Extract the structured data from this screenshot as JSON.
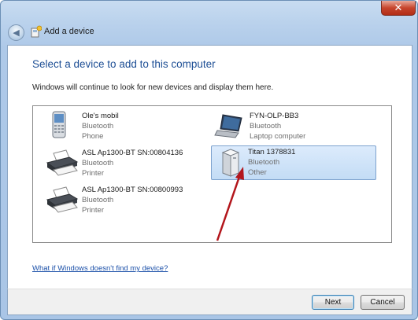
{
  "window": {
    "title": "Add a device",
    "close_glyph": "✕"
  },
  "header": {
    "heading": "Select a device to add to this computer",
    "subtext": "Windows will continue to look for new devices and display them here."
  },
  "devices": [
    {
      "name": "Ole's mobil",
      "connection": "Bluetooth",
      "type": "Phone",
      "icon": "phone-icon",
      "selected": false
    },
    {
      "name": "FYN-OLP-BB3",
      "connection": "Bluetooth",
      "type": "Laptop computer",
      "icon": "laptop-icon",
      "selected": false
    },
    {
      "name": "ASL Ap1300-BT SN:00804136",
      "connection": "Bluetooth",
      "type": "Printer",
      "icon": "printer-icon",
      "selected": false
    },
    {
      "name": "Titan 1378831",
      "connection": "Bluetooth",
      "type": "Other",
      "icon": "generic-device-icon",
      "selected": true
    },
    {
      "name": "ASL Ap1300-BT SN:00800993",
      "connection": "Bluetooth",
      "type": "Printer",
      "icon": "printer-icon",
      "selected": false
    }
  ],
  "help_link": "What if Windows doesn't find my device?",
  "buttons": {
    "next": "Next",
    "cancel": "Cancel"
  },
  "colors": {
    "heading": "#1e4f95",
    "link": "#1a4fa8",
    "selection": "#c3dcf5",
    "annotation_arrow": "#b3161c"
  }
}
